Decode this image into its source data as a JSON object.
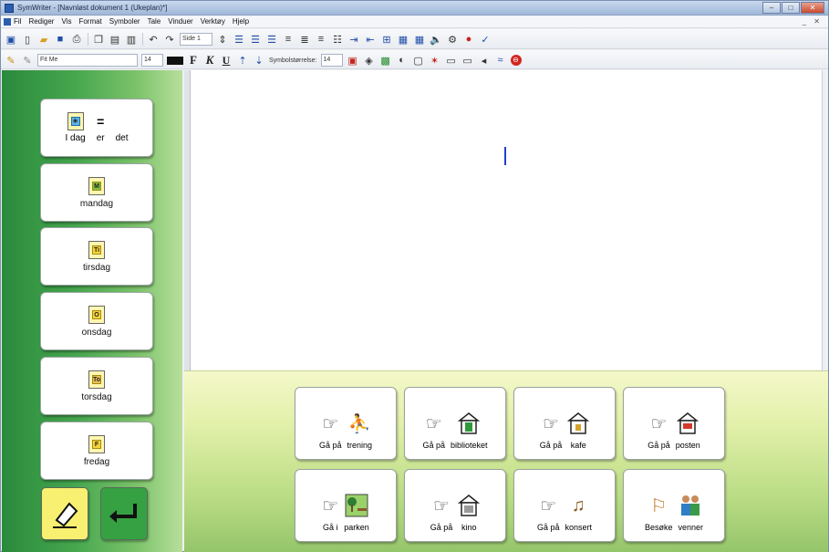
{
  "window": {
    "title": "SymWriter - [Navnløst dokument 1 (Ukeplan)*]",
    "controls": [
      "–",
      "□",
      "✕"
    ],
    "mdi_controls": "_ ✕"
  },
  "menu": {
    "items": [
      "Fil",
      "Rediger",
      "Vis",
      "Format",
      "Symboler",
      "Tale",
      "Vinduer",
      "Verktøy",
      "Hjelp"
    ]
  },
  "toolbar1": {
    "page_combo": "Side 1",
    "icons": [
      "frame-icon",
      "new-doc-icon",
      "open-icon",
      "save-icon",
      "print-icon",
      "copy-icon",
      "paste-icon",
      "clipboard-icon",
      "undo-icon",
      "redo-icon",
      "align-left-icon",
      "align-center-icon",
      "align-right-icon",
      "justify-icon",
      "bullets-icon",
      "indent-icon",
      "table-icon",
      "speak-icon",
      "spell-icon"
    ]
  },
  "toolbar2": {
    "font_combo": "Fit Me",
    "font_size": "14",
    "bold_label": "F",
    "italic_label": "K",
    "underline_label": "U",
    "symbol_size_label": "Symbolstørrelse:",
    "symbol_size": "14"
  },
  "days": [
    {
      "id": "monday",
      "letter": "M",
      "label": "mandag"
    },
    {
      "id": "tuesday",
      "letter": "Ti",
      "label": "tirsdag"
    },
    {
      "id": "wednesday",
      "letter": "O",
      "label": "onsdag"
    },
    {
      "id": "thursday",
      "letter": "To",
      "label": "torsdag"
    },
    {
      "id": "friday",
      "letter": "F",
      "label": "fredag"
    }
  ],
  "today": {
    "words": [
      "I dag",
      "er",
      "det"
    ],
    "equals": "="
  },
  "activities": [
    {
      "id": "trening",
      "words": [
        "Gå på",
        "trening"
      ]
    },
    {
      "id": "biblioteket",
      "words": [
        "Gå på",
        "biblioteket"
      ]
    },
    {
      "id": "kafe",
      "words": [
        "Gå på",
        "kafe"
      ]
    },
    {
      "id": "posten",
      "words": [
        "Gå på",
        "posten"
      ]
    },
    {
      "id": "parken",
      "words": [
        "Gå i",
        "parken"
      ]
    },
    {
      "id": "kino",
      "words": [
        "Gå på",
        "kino"
      ]
    },
    {
      "id": "konsert",
      "words": [
        "Gå på",
        "konsert"
      ]
    },
    {
      "id": "venner",
      "words": [
        "Besøke",
        "venner"
      ]
    }
  ],
  "colors": {
    "left_panel": "#45a64e",
    "caret": "#1f3fd0",
    "enter_button": "#35a143",
    "eraser_button": "#f8f070"
  }
}
